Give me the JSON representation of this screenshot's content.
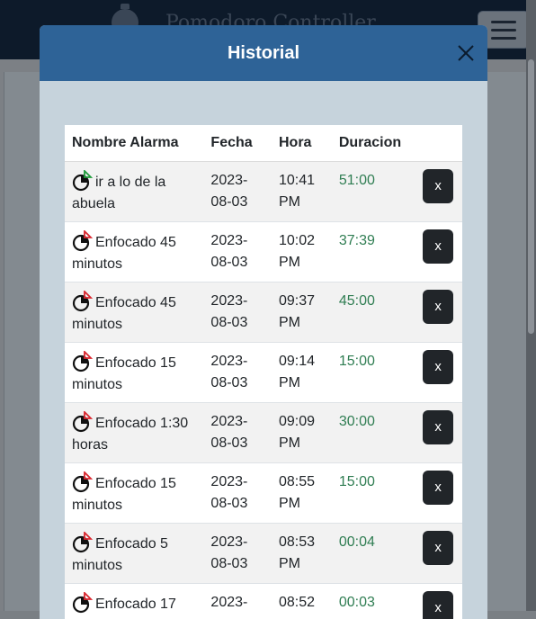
{
  "background": {
    "brand": "Pomodoro Controller",
    "brand_icon": "stopwatch-icon",
    "menu_icon": "hamburger-menu-icon"
  },
  "modal": {
    "title": "Historial",
    "close_icon": "close-icon",
    "header_color": "#2e6397"
  },
  "table": {
    "headers": {
      "name": "Nombre Alarma",
      "date": "Fecha",
      "time": "Hora",
      "duration": "Duracion"
    },
    "rows": [
      {
        "icon": "clock-success-icon",
        "name": "ir a lo de la abuela",
        "date": "2023-08-03",
        "time": "10:41 PM",
        "duration": "51:00",
        "delete": "x"
      },
      {
        "icon": "clock-alert-icon",
        "name": "Enfocado 45 minutos",
        "date": "2023-08-03",
        "time": "10:02 PM",
        "duration": "37:39",
        "delete": "x"
      },
      {
        "icon": "clock-alert-icon",
        "name": "Enfocado 45 minutos",
        "date": "2023-08-03",
        "time": "09:37 PM",
        "duration": "45:00",
        "delete": "x"
      },
      {
        "icon": "clock-alert-icon",
        "name": "Enfocado 15 minutos",
        "date": "2023-08-03",
        "time": "09:14 PM",
        "duration": "15:00",
        "delete": "x"
      },
      {
        "icon": "clock-alert-icon",
        "name": "Enfocado 1:30 horas",
        "date": "2023-08-03",
        "time": "09:09 PM",
        "duration": "30:00",
        "delete": "x"
      },
      {
        "icon": "clock-alert-icon",
        "name": "Enfocado 15 minutos",
        "date": "2023-08-03",
        "time": "08:55 PM",
        "duration": "15:00",
        "delete": "x"
      },
      {
        "icon": "clock-alert-icon",
        "name": "Enfocado 5 minutos",
        "date": "2023-08-03",
        "time": "08:53 PM",
        "duration": "00:04",
        "delete": "x"
      },
      {
        "icon": "clock-alert-icon",
        "name": "Enfocado 17",
        "date": "2023-",
        "time": "08:52",
        "duration": "00:03",
        "delete": "x"
      }
    ]
  },
  "colors": {
    "duration": "#2f7d52",
    "success_flag": "#1e9b3a",
    "alert_flag": "#d9262e",
    "delete_button": "#212529"
  }
}
